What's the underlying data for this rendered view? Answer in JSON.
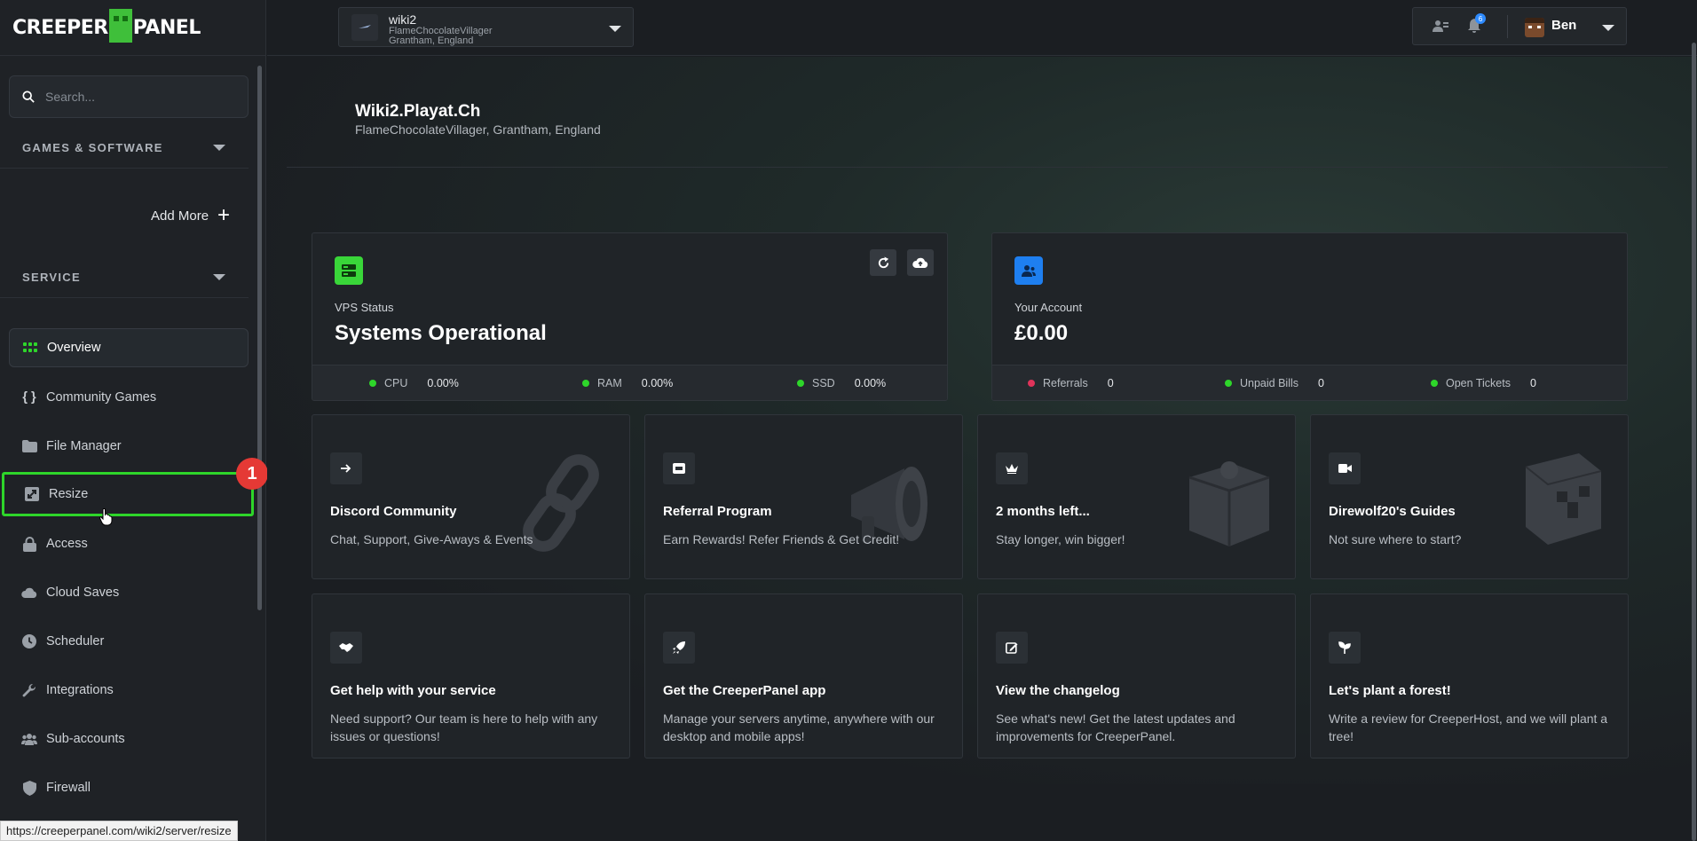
{
  "brand": {
    "logo_text_left": "CREEPER",
    "logo_text_right": "PANEL"
  },
  "sidebar": {
    "search_placeholder": "Search...",
    "section_games": "GAMES & SOFTWARE",
    "add_more": "Add More",
    "section_service": "SERVICE",
    "items": [
      {
        "label": "Overview",
        "icon": "grid-icon"
      },
      {
        "label": "Community Games",
        "icon": "braces-icon"
      },
      {
        "label": "File Manager",
        "icon": "folder-icon"
      },
      {
        "label": "Resize",
        "icon": "resize-icon"
      },
      {
        "label": "Access",
        "icon": "lock-icon"
      },
      {
        "label": "Cloud Saves",
        "icon": "cloud-icon"
      },
      {
        "label": "Scheduler",
        "icon": "clock-icon"
      },
      {
        "label": "Integrations",
        "icon": "wrench-icon"
      },
      {
        "label": "Sub-accounts",
        "icon": "users-icon"
      },
      {
        "label": "Firewall",
        "icon": "shield-icon"
      }
    ],
    "badge": "1"
  },
  "status_url": "https://creeperpanel.com/wiki2/server/resize",
  "topbar": {
    "server_name": "wiki2",
    "server_host": "FlameChocolateVillager",
    "server_location": "Grantham, England",
    "notification_count": "6",
    "username": "Ben"
  },
  "hero": {
    "title": "Wiki2.Playat.Ch",
    "subtitle": "FlameChocolateVillager, Grantham, England"
  },
  "vps": {
    "label": "VPS Status",
    "value": "Systems Operational",
    "metrics": [
      {
        "name": "CPU",
        "value": "0.00%",
        "color": "#2ed62a"
      },
      {
        "name": "RAM",
        "value": "0.00%",
        "color": "#2ed62a"
      },
      {
        "name": "SSD",
        "value": "0.00%",
        "color": "#2ed62a"
      }
    ]
  },
  "account": {
    "label": "Your Account",
    "value": "£0.00",
    "metrics": [
      {
        "name": "Referrals",
        "value": "0",
        "color": "#e0335a"
      },
      {
        "name": "Unpaid Bills",
        "value": "0",
        "color": "#2ed62a"
      },
      {
        "name": "Open Tickets",
        "value": "0",
        "color": "#2ed62a"
      }
    ]
  },
  "cards": [
    {
      "title": "Discord Community",
      "text": "Chat, Support, Give-Aways & Events",
      "icon": "arrow-right-icon"
    },
    {
      "title": "Referral Program",
      "text": "Earn Rewards! Refer Friends & Get Credit!",
      "icon": "ticket-icon"
    },
    {
      "title": "2 months left...",
      "text": "Stay longer, win bigger!",
      "icon": "crown-icon"
    },
    {
      "title": "Direwolf20's Guides",
      "text": "Not sure where to start?",
      "icon": "video-icon"
    },
    {
      "title": "Get help with your service",
      "text": "Need support? Our team is here to help with any issues or questions!",
      "icon": "handshake-icon"
    },
    {
      "title": "Get the CreeperPanel app",
      "text": "Manage your servers anytime, anywhere with our desktop and mobile apps!",
      "icon": "rocket-icon"
    },
    {
      "title": "View the changelog",
      "text": "See what's new! Get the latest updates and improvements for CreeperPanel.",
      "icon": "edit-icon"
    },
    {
      "title": "Let's plant a forest!",
      "text": "Write a review for CreeperHost, and we will plant a tree!",
      "icon": "sprout-icon"
    }
  ],
  "colors": {
    "accent_green": "#2ed62a",
    "vps_icon": "#39d639",
    "account_icon": "#1e7ff0",
    "badge_red": "#e53935"
  }
}
